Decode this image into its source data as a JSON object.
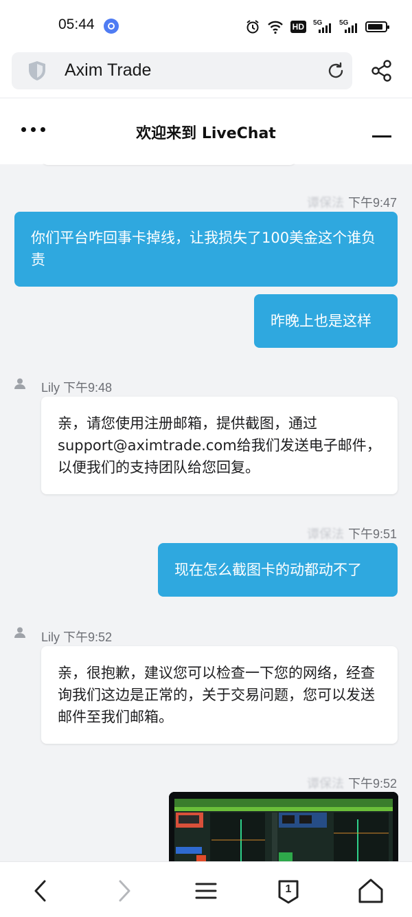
{
  "status_bar": {
    "time": "05:44",
    "hd_badge": "HD",
    "signal_1_label": "5G",
    "signal_2_label": "5G"
  },
  "browser": {
    "site_name": "Axim Trade",
    "icons": [
      "shield-icon",
      "reload-icon",
      "share-icon"
    ]
  },
  "chat_header": {
    "title": "欢迎来到 LiveChat"
  },
  "messages": [
    {
      "side": "out",
      "sender_blurred": "谭保法",
      "time": "下午9:47",
      "text": "你们平台咋回事卡掉线，让我损失了100美金这个谁负责"
    },
    {
      "side": "out",
      "text": "昨晚上也是这样"
    },
    {
      "side": "in",
      "sender": "Lily",
      "time": "下午9:48",
      "text": "亲，请您使用注册邮箱，提供截图，通过support@aximtrade.com给我们发送电子邮件，以便我们的支持团队给您回复。"
    },
    {
      "side": "out",
      "sender_blurred": "谭保法",
      "time": "下午9:51",
      "text": "现在怎么截图卡的动都动不了"
    },
    {
      "side": "in",
      "sender": "Lily",
      "time": "下午9:52",
      "text": "亲，很抱歉，建议您可以检查一下您的网络，经查询我们这边是正常的，关于交易问题，您可以发送邮件至我们邮箱。"
    },
    {
      "side": "out",
      "sender_blurred": "谭保法",
      "time": "下午9:52",
      "type": "image"
    }
  ],
  "bottom_nav": {
    "tab_count": "1",
    "icons": [
      "back-icon",
      "forward-icon",
      "menu-icon",
      "tabs-icon",
      "home-icon"
    ]
  },
  "colors": {
    "outgoing_bubble": "#2fa8df",
    "incoming_bubble": "#ffffff",
    "background": "#f2f3f5"
  }
}
